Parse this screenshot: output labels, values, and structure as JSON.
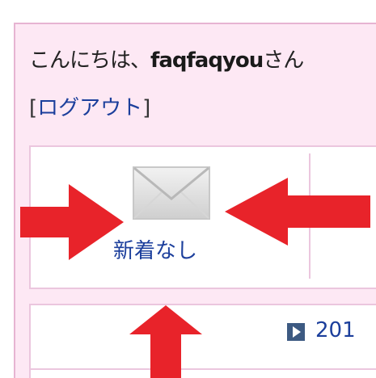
{
  "greeting": {
    "prefix": "こんにちは、",
    "username": "faqfaqyou",
    "suffix": "さん"
  },
  "logout": {
    "open_bracket": "[",
    "label": "ログアウト",
    "close_bracket": "]"
  },
  "mail": {
    "icon": "envelope-icon",
    "status": "新着なし"
  },
  "news": {
    "icon": "play-icon",
    "text": "201"
  },
  "annotations": {
    "arrow_color": "#e8232a",
    "arrows": [
      "arrow-right",
      "arrow-left",
      "arrow-up"
    ]
  },
  "colors": {
    "panel_bg": "#fde8f4",
    "panel_border": "#e6b4d2",
    "link": "#1c3f9c"
  }
}
